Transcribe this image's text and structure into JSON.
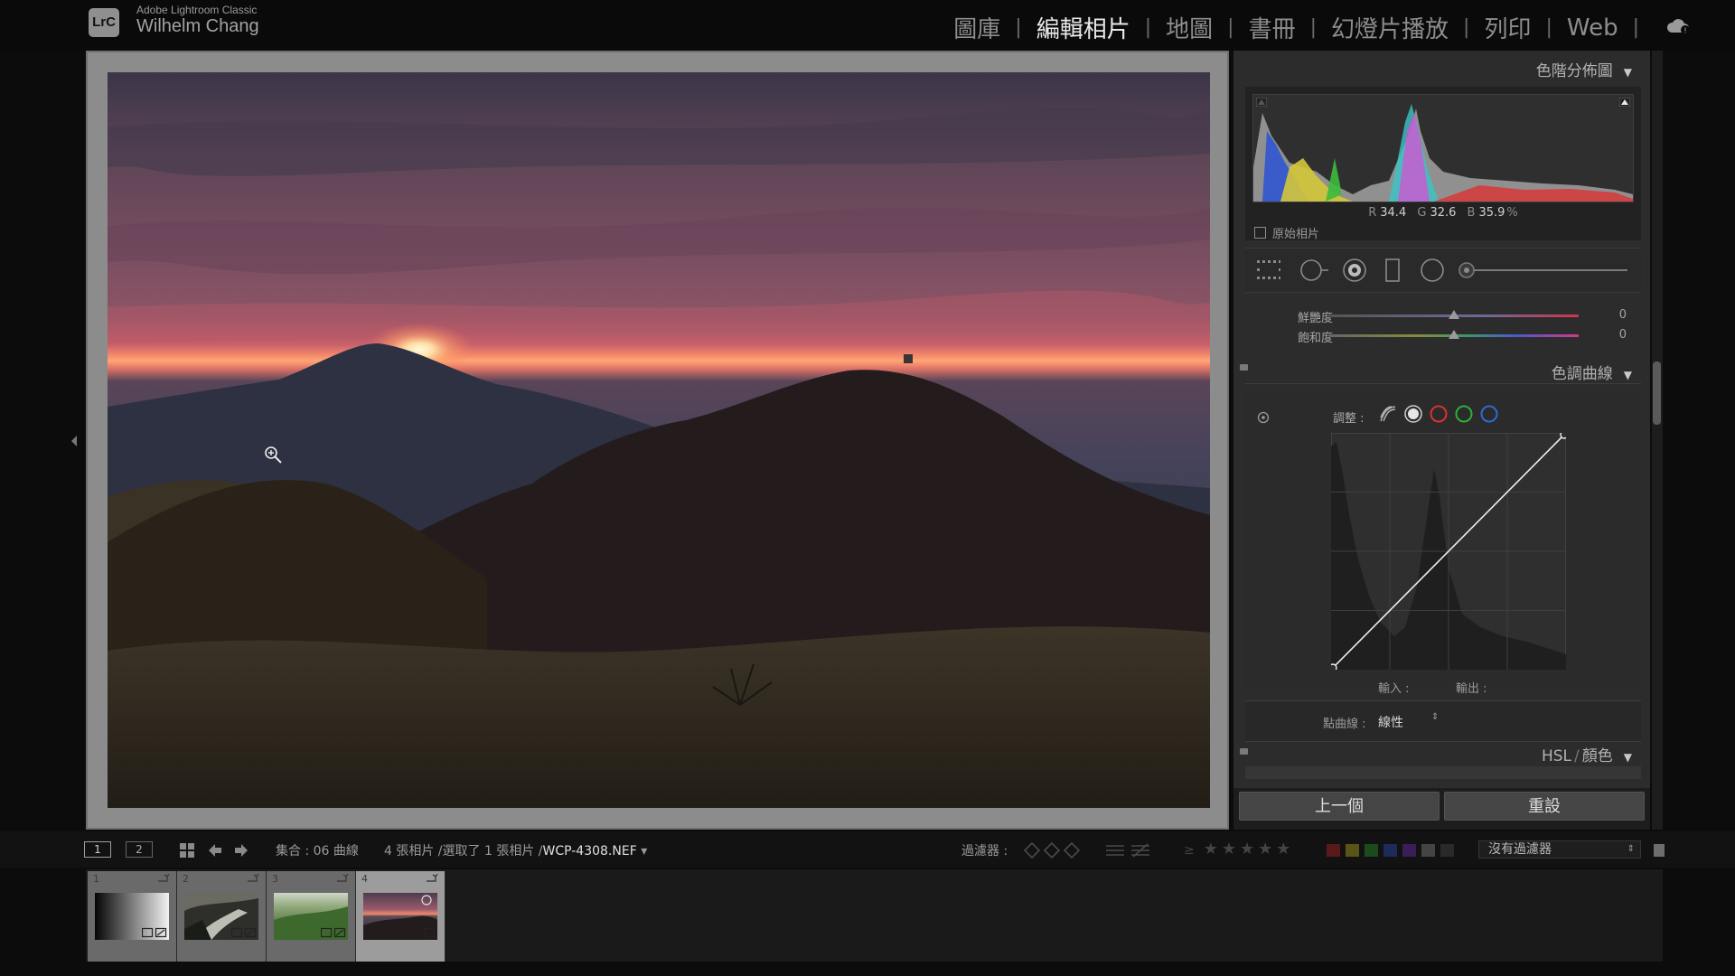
{
  "identity": {
    "badge": "LrC",
    "product": "Adobe Lightroom Classic",
    "user": "Wilhelm Chang"
  },
  "modules": [
    {
      "label": "圖庫",
      "active": false
    },
    {
      "label": "編輯相片",
      "active": true
    },
    {
      "label": "地圖",
      "active": false
    },
    {
      "label": "書冊",
      "active": false
    },
    {
      "label": "幻燈片播放",
      "active": false
    },
    {
      "label": "列印",
      "active": false
    },
    {
      "label": "Web",
      "active": false
    }
  ],
  "module_separator": "|",
  "icons": {
    "cloud": "cloud-sync-icon",
    "zoom": "zoom-in-cursor-icon",
    "panel_toggle": "left-panel-arrow-icon"
  },
  "histogram": {
    "title": "色階分佈圖",
    "r_label": "R",
    "r_value": "34.4",
    "g_label": "G",
    "g_value": "32.6",
    "b_label": "B",
    "b_value": "35.9",
    "unit": "%",
    "original_photo_label": "原始相片"
  },
  "tool_strip": {
    "tools": [
      "crop-overlay-icon",
      "spot-removal-icon",
      "red-eye-icon",
      "graduated-filter-icon",
      "radial-filter-icon",
      "adjustment-brush-slider"
    ]
  },
  "presence": {
    "vibrance_label": "鮮艷度",
    "vibrance_value": "0",
    "saturation_label": "飽和度",
    "saturation_value": "0"
  },
  "tone_curve": {
    "title": "色調曲線",
    "adjust_label": "調整 :",
    "channels": [
      "parametric-curve-icon",
      "rgb-point-curve-icon",
      "red-channel-icon",
      "green-channel-icon",
      "blue-channel-icon"
    ],
    "input_label": "輸入 :",
    "output_label": "輸出 :",
    "point_curve_label": "點曲線 :",
    "point_curve_value": "線性"
  },
  "hsl": {
    "title": "HSL",
    "separator": "/",
    "color_label": "顏色"
  },
  "buttons": {
    "previous": "上一個",
    "reset": "重設"
  },
  "filmstrip_bar": {
    "view1": "1",
    "view2": "2",
    "collection_text": "集合 : 06 曲線",
    "count_text": "4 張相片 /選取了 1 張相片 /",
    "filename": "WCP-4308.NEF",
    "filename_arrow": "▾",
    "filter_label": "過濾器 :",
    "rating_prefix": "≥",
    "stars": "★★★★★",
    "colors": [
      "#5a1a1a",
      "#5a5418",
      "#1c4a1c",
      "#1c2a5c",
      "#3a1e5a",
      "#444444",
      "#2a2a2a"
    ],
    "no_filter": "沒有過濾器",
    "no_filter_arrow": "⇕"
  },
  "filmstrip": [
    {
      "num": "1",
      "selected": false,
      "thumb": "gradient"
    },
    {
      "num": "2",
      "selected": false,
      "thumb": "path"
    },
    {
      "num": "3",
      "selected": false,
      "thumb": "grass"
    },
    {
      "num": "4",
      "selected": true,
      "thumb": "sunset"
    }
  ],
  "colors": {
    "accent_active_module": "#e9e9e9",
    "panel_bg": "#2c2c2c",
    "red_channel": "#d93131",
    "green_channel": "#2fae3a",
    "blue_channel": "#2f6ad9"
  }
}
